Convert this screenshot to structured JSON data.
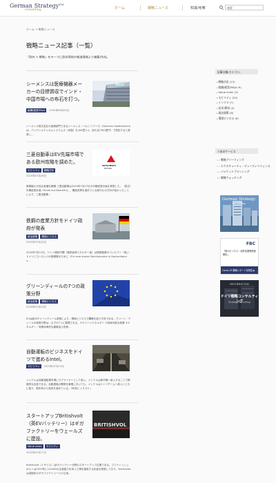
{
  "header": {
    "logo_main": "German Strategy",
    "logo_tm": "TM",
    "logo_sub": "consulting",
    "nav": [
      "ホーム",
      "戦略ニュース",
      "知識/考察"
    ],
    "search_placeholder": "検索"
  },
  "breadcrumb": "ホーム > 戦略ニュース",
  "page": {
    "title": "戦略ニュース記事（一覧）",
    "description": "「欧州 × 戦略」をテーマに欧米現地の報道情報より編集/作成。"
  },
  "articles": [
    {
      "title": "シーメンスは医療機器メーカーの目標買収でインド・中国市場への布石を打つ。",
      "tags": [
        "組織/経営/M&A"
      ],
      "date": "2020年06月02日",
      "excerpt": "シーメンス株式会社の医療部門であるシーメンス・ヘルシニアーズ（Siemens Healthineers）は、バリアンメディカルシステムズ（米国）を164億ドル（約1兆7300億円）で買収すると発表し..."
    },
    {
      "title": "三菱自動車はEV先端市場である欧州攻略を調めた。",
      "tags": [
        "モビリティ",
        "戦略方針"
      ],
      "date": "2020年07月28日",
      "excerpt": "事業縮小が迫る各種な業績 三菱自動車は2020年7月27日の中期経営計画を発表した。（英文）中期経営計画「Small but Beautiful」。構造改革を進めている新中心の方針が加わったことにより、三菱自動車..."
    },
    {
      "title": "鉄鋼の産業方針をドイツ政府が発表",
      "tags": [
        "政治政策",
        "環境ビジネス"
      ],
      "date": "2020年07月20日",
      "excerpt": "2020年7月15日、ドイツ連邦内閣（連邦経済エネルギー省）は鉄鋼産業のコンセプト「強いドイツとヨーロッパの鉄鋼業のために（Für eine starke Stahlindustrie in Deutschland u..."
    },
    {
      "title": "グリーンディールの7つの政策分野",
      "tags": [
        "政治政策",
        "環境ビジネス"
      ],
      "date": "2020年07月03日",
      "excerpt": "EUは欧州グリーンディール政策により、環境ビジネスで覇権を狙う方針である。グリーン・ディールの政策分野は、以下の7つに整理される。①クリーンエネルギー ②持続可能な産業 ③エネルギー・資源効率的な建築及び改修..."
    },
    {
      "title": "自動運転のビジネスをドイツで進めるIntel。",
      "tags": [
        "モビリティ"
      ],
      "date": "2020年07月19日",
      "excerpt": "インテルは自動運転車市場にサプライヤーとして参入。インテルは新市場へ参入することで積極的な自信である。自動運転の開発を事業においても、インテルはドイツチームへ参入とともに取り、数年前から投資を進めている。3年前にイスラエ..."
    },
    {
      "title": "スタートアップBritishvolt（英EVバッテリー）はギガファクトリーをウェールズに建設。",
      "tags": [
        "Value chain",
        "モビリティ"
      ],
      "date": "2020年07月17日",
      "excerpt": "Britishvolt（イギリス）はEVバッテリー分野のスタートアップ企業である。ブリティッシュボルトは2023年に12GWhの生産能力を持つ工場を建設する計画を発表しており、Britishvoltは英国初のギガファクトリーとの立地..."
    }
  ],
  "sidebar": {
    "categories_heading": "記事分類(カテゴリ)",
    "categories": [
      "戦略方針 (13)",
      "組織/経営/M&A (9)",
      "Value chain (3)",
      "モビリティ (24)",
      "インフラ (7)",
      "化学/素材 (4)",
      "政治政策 (8)",
      "環境ビジネス (6)"
    ],
    "services_heading": "人気のサービス",
    "services": [
      "戦略ブリーフィング",
      "エクスキューティ・デューディリジェンス",
      "ジャケットプランニング",
      "戦略ウォッチング"
    ],
    "banners": [
      {
        "top": "German Strategy",
        "sub": "consulting"
      },
      {
        "brand": "FBC",
        "title": "「欧州ビジネス・政府支援策調査報告」",
        "cta": "Covid-19 戦略レポートを閲覧 ▶"
      },
      {
        "top": "INFORMATION",
        "title": "ドイツ戦略コンサルティング",
        "sub": "Strategy Consulting"
      }
    ]
  },
  "colors": {
    "brand_navy": "#2f3b59",
    "brand_gold": "#b08a3a",
    "tag_bg": "#2f3b6e"
  }
}
